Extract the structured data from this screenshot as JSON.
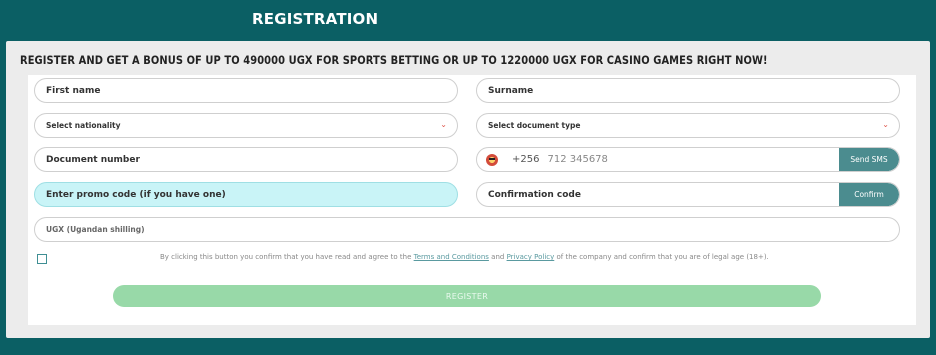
{
  "page": {
    "title": "REGISTRATION"
  },
  "headline": "REGISTER AND GET A BONUS OF UP TO 490000 UGX FOR SPORTS BETTING OR UP TO 1220000 UGX FOR CASINO GAMES RIGHT NOW!",
  "form": {
    "first_name": "First name",
    "surname": "Surname",
    "nationality": "Select nationality",
    "document_type": "Select document type",
    "document_number": "Document number",
    "phone_code": "+256",
    "phone_placeholder": "712 345678",
    "send_sms": "Send SMS",
    "promo": "Enter promo code (if you have one)",
    "confirmation_code": "Confirmation code",
    "confirm": "Confirm",
    "currency": "UGX (Ugandan shilling)"
  },
  "agreement": {
    "prefix": "By clicking this button you confirm that you have read and agree to the",
    "terms": "Terms and Conditions",
    "and": "and",
    "privacy": "Privacy Policy",
    "suffix": "of the company and confirm that you are of legal age (18+)."
  },
  "register_label": "REGISTER",
  "colors": {
    "background": "#0b5f64",
    "accent": "#4b8c8f",
    "register": "#98d9a8",
    "promo": "#c9f4f7"
  },
  "icons": {
    "dropdown": "chevron-down-icon",
    "flag": "uganda-flag-icon"
  }
}
